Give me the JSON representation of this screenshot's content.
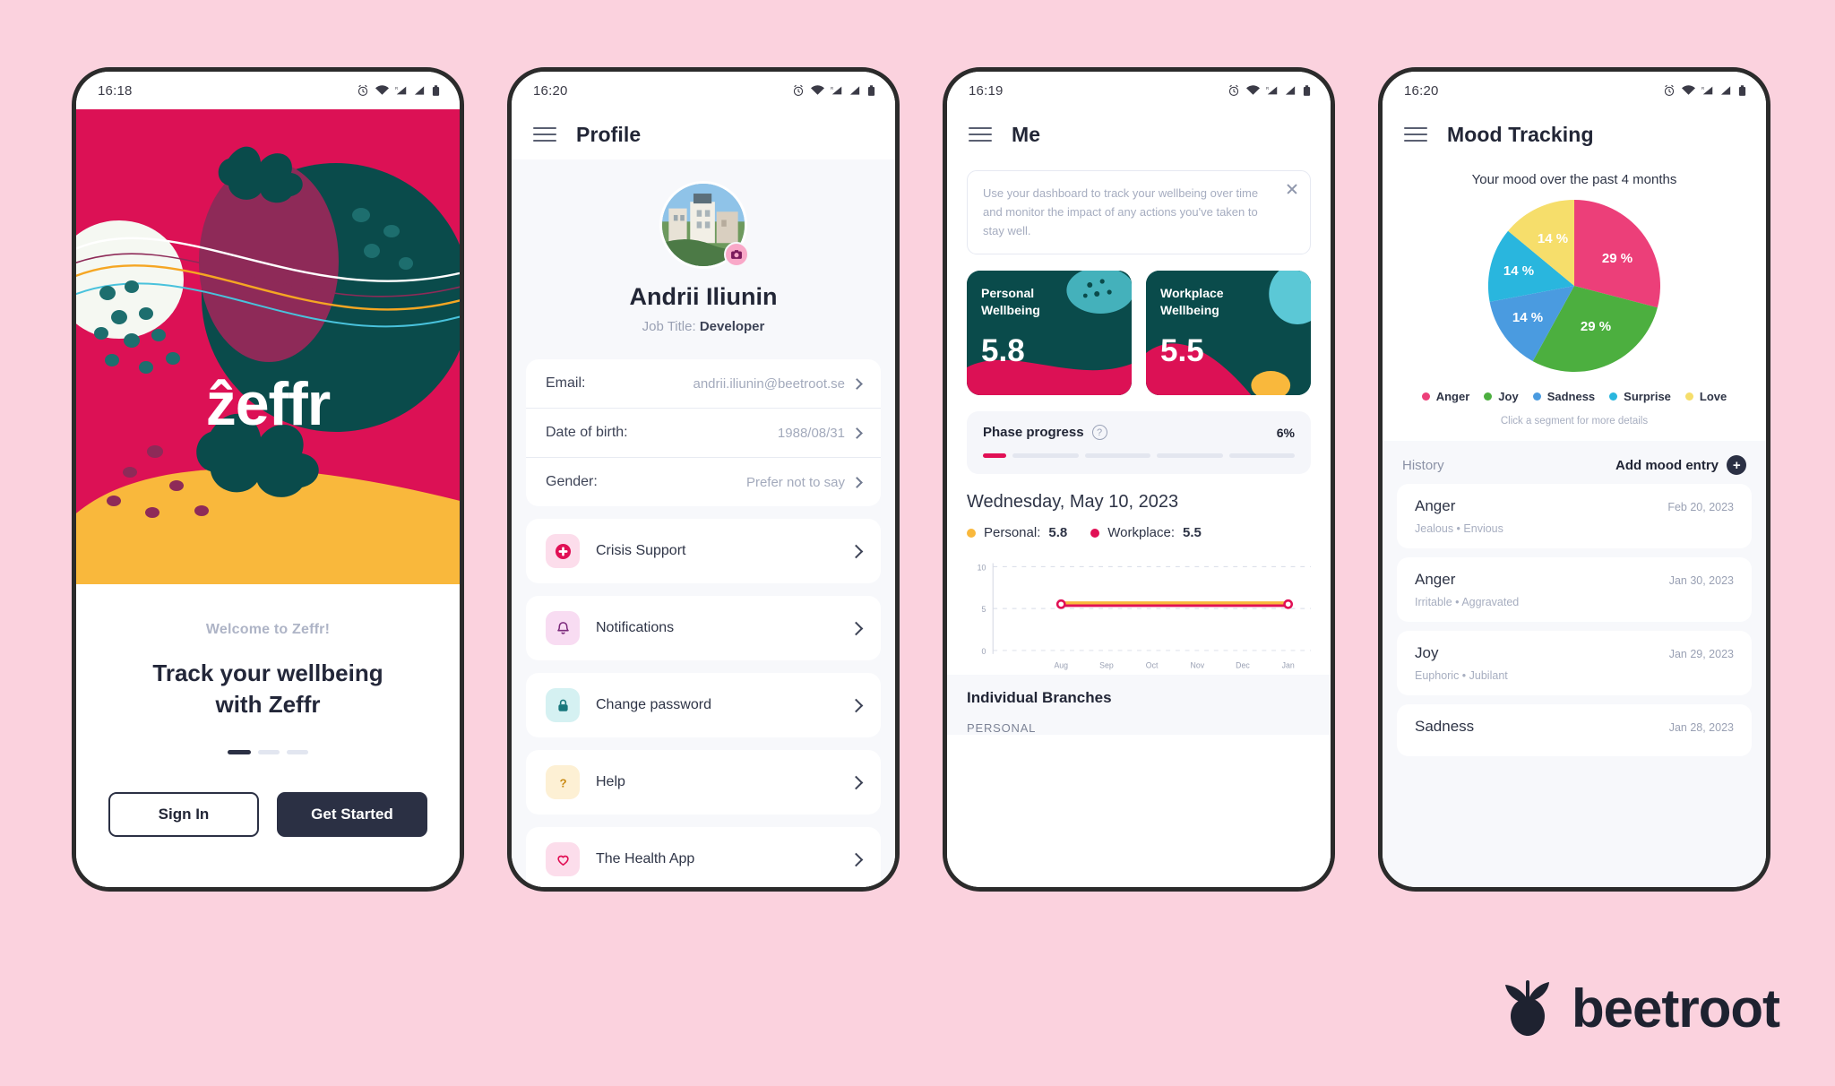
{
  "brand": {
    "name": "beetroot",
    "logo_icon": "beetroot-icon",
    "bg": "#FBD2DE"
  },
  "colors": {
    "crimson": "#DC1155",
    "teal": "#0A4B4B",
    "yellow": "#F9B83C",
    "ink": "#2B3044",
    "muted": "#A3AABC"
  },
  "phone1": {
    "status": {
      "time": "16:18",
      "icons": [
        "alarm-icon",
        "wifi-icon",
        "signal-roaming-icon",
        "signal-icon",
        "battery-icon"
      ]
    },
    "wordmark": "ẑeffr",
    "welcome": "Welcome to Zeffr!",
    "headline_line1": "Track your wellbeing",
    "headline_line2": "with Zeffr",
    "dots": {
      "count": 3,
      "active": 0
    },
    "sign_in_label": "Sign In",
    "get_started_label": "Get Started"
  },
  "phone2": {
    "status": {
      "time": "16:20"
    },
    "title": "Profile",
    "menu_icon": "hamburger-icon",
    "avatar_badge_icon": "camera-icon",
    "name": "Andrii Iliunin",
    "job_title_label": "Job Title:",
    "job_title_value": "Developer",
    "fields": [
      {
        "label": "Email:",
        "value": "andrii.iliunin@beetroot.se"
      },
      {
        "label": "Date of birth:",
        "value": "1988/08/31"
      },
      {
        "label": "Gender:",
        "value": "Prefer not to say"
      }
    ],
    "menu": [
      {
        "label": "Crisis Support",
        "icon": "medical-cross-icon",
        "icon_bg": "#FCDDEB",
        "icon_color": "#E11055"
      },
      {
        "label": "Notifications",
        "icon": "bell-icon",
        "icon_bg": "#F8DCF2",
        "icon_color": "#7B2A7B"
      },
      {
        "label": "Change password",
        "icon": "lock-icon",
        "icon_bg": "#D5F1F2",
        "icon_color": "#18777C"
      },
      {
        "label": "Help",
        "icon": "question-icon",
        "icon_bg": "#FDF0D4",
        "icon_color": "#C98A14"
      },
      {
        "label": "The Health App",
        "icon": "heart-icon",
        "icon_bg": "#FCDDEB",
        "icon_color": "#E11055"
      }
    ]
  },
  "phone3": {
    "status": {
      "time": "16:19"
    },
    "title": "Me",
    "menu_icon": "hamburger-icon",
    "tip": "Use your dashboard to track your wellbeing over time and monitor the impact of any actions you've taken to stay well.",
    "tip_close_icon": "close-icon",
    "scores": [
      {
        "title_line1": "Personal",
        "title_line2": "Wellbeing",
        "value": "5.8"
      },
      {
        "title_line1": "Workplace",
        "title_line2": "Wellbeing",
        "value": "5.5"
      }
    ],
    "phase": {
      "label": "Phase progress",
      "help_icon": "question-circle-icon",
      "percent": "6%",
      "segments": 5,
      "filled_fraction": 0.3
    },
    "date": "Wednesday, May 10, 2023",
    "legend": [
      {
        "label": "Personal:",
        "value": "5.8",
        "color": "#F9B83C"
      },
      {
        "label": "Workplace:",
        "value": "5.5",
        "color": "#E11055"
      }
    ],
    "branches_title": "Individual Branches",
    "branches_sub": "PERSONAL",
    "chart_data": {
      "type": "line",
      "title": "",
      "x": [
        "Aug",
        "Sep",
        "Oct",
        "Nov",
        "Dec",
        "Jan"
      ],
      "yticks": [
        0,
        5,
        10
      ],
      "ylim": [
        0,
        10
      ],
      "grid": true,
      "series": [
        {
          "name": "Personal",
          "color": "#F9B83C",
          "values": [
            5.8,
            5.8,
            5.8,
            5.8,
            null,
            null
          ]
        },
        {
          "name": "Workplace",
          "color": "#E11055",
          "values": [
            5.5,
            5.5,
            5.5,
            5.5,
            null,
            null
          ]
        }
      ],
      "note": "Flat overlapping lines Aug-Nov with endpoint markers"
    }
  },
  "phone4": {
    "status": {
      "time": "16:20"
    },
    "title": "Mood Tracking",
    "menu_icon": "hamburger-icon",
    "subtitle": "Your mood over the past 4 months",
    "hint": "Click a segment for more details",
    "history_label": "History",
    "add_entry_label": "Add mood entry",
    "add_entry_icon": "plus-circle-icon",
    "chart_data": {
      "type": "pie",
      "title": "Your mood over the past 4 months",
      "labels": [
        "Anger",
        "Joy",
        "Sadness",
        "Surprise",
        "Love"
      ],
      "values": [
        29,
        29,
        14,
        14,
        14
      ],
      "value_labels": [
        "29 %",
        "29 %",
        "14 %",
        "14 %",
        "14 %"
      ],
      "colors": [
        "#EC3F79",
        "#4CAF3F",
        "#4A9BE0",
        "#29B6DE",
        "#F6DE6B"
      ],
      "legend_position": "bottom",
      "legend": [
        {
          "label": "Anger",
          "color": "#EC3F79"
        },
        {
          "label": "Joy",
          "color": "#4CAF3F"
        },
        {
          "label": "Sadness",
          "color": "#4A9BE0"
        },
        {
          "label": "Surprise",
          "color": "#29B6DE"
        },
        {
          "label": "Love",
          "color": "#F6DE6B"
        }
      ]
    },
    "history": [
      {
        "mood": "Anger",
        "date": "Feb 20, 2023",
        "tags": "Jealous • Envious"
      },
      {
        "mood": "Anger",
        "date": "Jan 30, 2023",
        "tags": "Irritable • Aggravated"
      },
      {
        "mood": "Joy",
        "date": "Jan 29, 2023",
        "tags": "Euphoric • Jubilant"
      },
      {
        "mood": "Sadness",
        "date": "Jan 28, 2023",
        "tags": ""
      }
    ]
  }
}
